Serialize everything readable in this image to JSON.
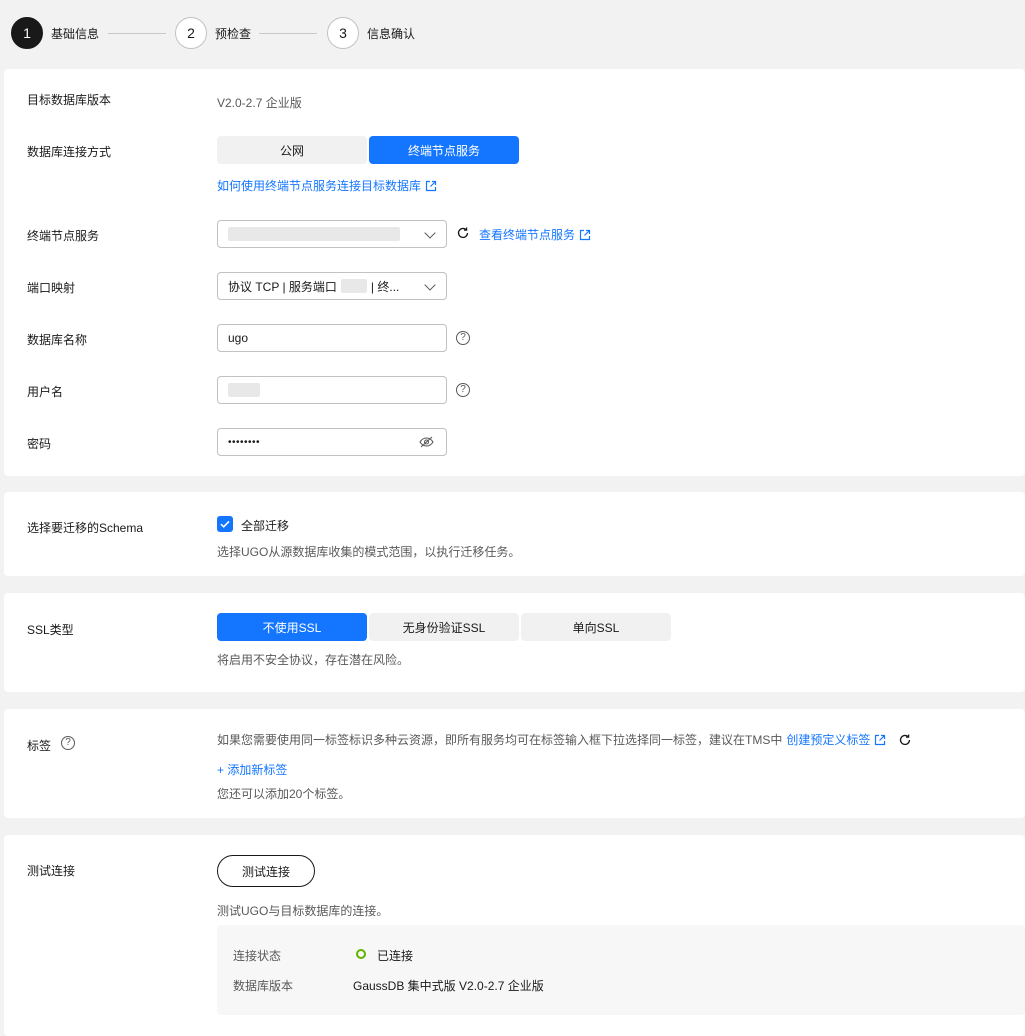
{
  "steps": [
    {
      "num": "1",
      "label": "基础信息"
    },
    {
      "num": "2",
      "label": "预检查"
    },
    {
      "num": "3",
      "label": "信息确认"
    }
  ],
  "basic": {
    "target_version_label": "目标数据库版本",
    "target_version_value": "V2.0-2.7 企业版",
    "conn_mode_label": "数据库连接方式",
    "conn_mode_options": [
      "公网",
      "终端节点服务"
    ],
    "conn_mode_selected": "终端节点服务",
    "conn_help_link": "如何使用终端节点服务连接目标数据库",
    "endpoint_label": "终端节点服务",
    "endpoint_view_link": "查看终端节点服务",
    "port_label": "端口映射",
    "port_value_prefix": "协议 TCP | 服务端口",
    "port_value_suffix": "| 终...",
    "dbname_label": "数据库名称",
    "dbname_value": "ugo",
    "user_label": "用户名",
    "password_label": "密码",
    "password_value": "••••••••"
  },
  "schema": {
    "label": "选择要迁移的Schema",
    "checkbox_label": "全部迁移",
    "checked": true,
    "hint": "选择UGO从源数据库收集的模式范围，以执行迁移任务。"
  },
  "ssl": {
    "label": "SSL类型",
    "options": [
      "不使用SSL",
      "无身份验证SSL",
      "单向SSL"
    ],
    "selected": "不使用SSL",
    "hint": "将启用不安全协议，存在潜在风险。"
  },
  "tags": {
    "label": "标签",
    "desc": "如果您需要使用同一标签标识多种云资源，即所有服务均可在标签输入框下拉选择同一标签，建议在TMS中",
    "create_link": "创建预定义标签",
    "add_link": "+ 添加新标签",
    "remaining": "您还可以添加20个标签。"
  },
  "test": {
    "label": "测试连接",
    "button": "测试连接",
    "hint": "测试UGO与目标数据库的连接。",
    "status_label": "连接状态",
    "status_value": "已连接",
    "version_label": "数据库版本",
    "version_value": "GaussDB 集中式版 V2.0-2.7 企业版"
  },
  "colors": {
    "accent": "#1476ff",
    "success": "#5eb400"
  }
}
